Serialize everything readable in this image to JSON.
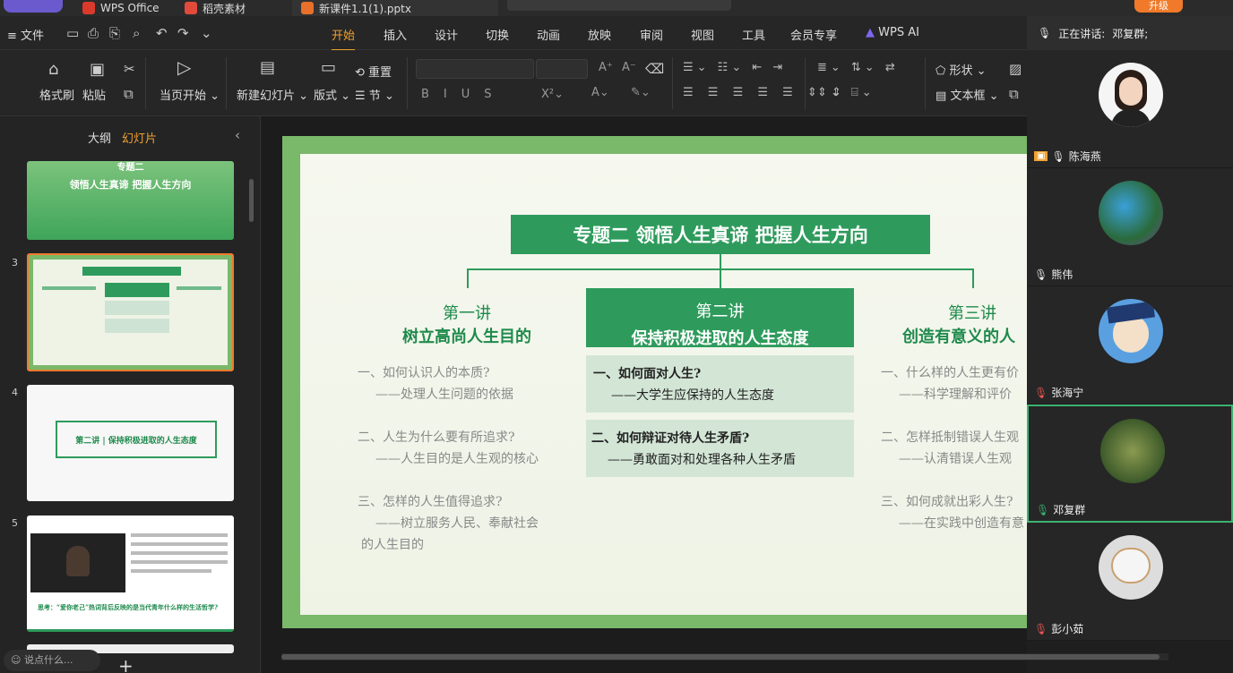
{
  "titlebar": {
    "tab_wps": "WPS Office",
    "tab_daoke": "稻壳素材",
    "tab_file": "新课件1.1(1).pptx",
    "upgrade": "升级"
  },
  "menu": {
    "file": "文件",
    "items": [
      "开始",
      "插入",
      "设计",
      "切换",
      "动画",
      "放映",
      "审阅",
      "视图",
      "工具",
      "会员专享",
      "WPS AI"
    ]
  },
  "ribbon": {
    "format_painter": "格式刷",
    "paste": "粘贴",
    "start_current": "当页开始",
    "new_slide": "新建幻灯片",
    "layout": "版式",
    "reset": "重置",
    "section": "节",
    "shape": "形状",
    "textbox": "文本框"
  },
  "leftpanel": {
    "tab_outline": "大纲",
    "tab_slides": "幻灯片",
    "slide_numbers": [
      "3",
      "4",
      "5"
    ],
    "thumb2_title": "专题二",
    "thumb2_sub": "领悟人生真谛  把握人生方向",
    "thumb4_text": "第二讲 | 保持积极进取的人生态度",
    "thumb5_caption": "思考：“爱你老己”热词背后反映的是当代青年什么样的生活哲学?",
    "chat_placeholder": "说点什么..."
  },
  "slide": {
    "title": "专题二  领悟人生真谛  把握人生方向",
    "col1_head1": "第一讲",
    "col1_head2": "树立高尚人生目的",
    "col2_head1": "第二讲",
    "col2_head2": "保持积极进取的人生态度",
    "col3_head1": "第三讲",
    "col3_head2": "创造有意义的人",
    "col1_q1": "一、如何认识人的本质?",
    "col1_a1": "——处理人生问题的依据",
    "col1_q2": "二、人生为什么要有所追求?",
    "col1_a2": "——人生目的是人生观的核心",
    "col1_q3": "三、怎样的人生值得追求?",
    "col1_a3a": "——树立服务人民、奉献社会",
    "col1_a3b": "的人生目的",
    "col2_q1": "一、如何面对人生?",
    "col2_a1": "——大学生应保持的人生态度",
    "col2_q2": "二、如何辩证对待人生矛盾?",
    "col2_a2": "——勇敢面对和处理各种人生矛盾",
    "col3_q1": "一、什么样的人生更有价",
    "col3_a1": "——科学理解和评价",
    "col3_q2": "二、怎样抵制错误人生观",
    "col3_a2": "——认清错误人生观",
    "col3_q3": "三、如何成就出彩人生?",
    "col3_a3": "——在实践中创造有意"
  },
  "meeting": {
    "speaking_label": "正在讲话:",
    "speaking_name": "邓复群;",
    "participants": [
      "陈海燕",
      "熊伟",
      "张海宁",
      "邓复群",
      "彭小茹"
    ]
  },
  "colors": {
    "accent_orange": "#f0a030",
    "slide_green": "#2e9b5c",
    "green_text": "#1f8a4c",
    "active_border": "#3cb371"
  }
}
